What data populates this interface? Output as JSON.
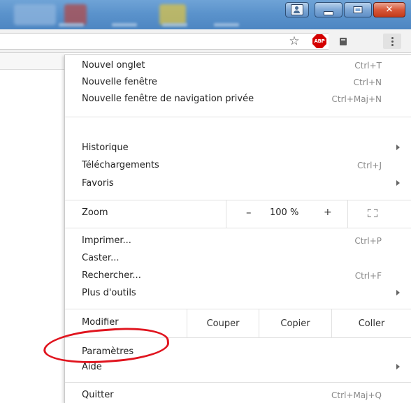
{
  "toolbar": {
    "bookmark_icon": "star-icon",
    "adblock_badge": "ABP",
    "extension_icon": "extension-icon",
    "menu_icon": "kebab-icon"
  },
  "menu": {
    "new_tab": {
      "label": "Nouvel onglet",
      "shortcut": "Ctrl+T"
    },
    "new_window": {
      "label": "Nouvelle fenêtre",
      "shortcut": "Ctrl+N"
    },
    "new_private_window": {
      "label": "Nouvelle fenêtre de navigation privée",
      "shortcut": "Ctrl+Maj+N"
    },
    "history": {
      "label": "Historique"
    },
    "downloads": {
      "label": "Téléchargements",
      "shortcut": "Ctrl+J"
    },
    "bookmarks": {
      "label": "Favoris"
    },
    "zoom": {
      "label": "Zoom",
      "minus": "–",
      "value": "100 %",
      "plus": "+"
    },
    "print": {
      "label": "Imprimer...",
      "shortcut": "Ctrl+P"
    },
    "cast": {
      "label": "Caster..."
    },
    "find": {
      "label": "Rechercher...",
      "shortcut": "Ctrl+F"
    },
    "more_tools": {
      "label": "Plus d'outils"
    },
    "edit": {
      "label": "Modifier",
      "cut": "Couper",
      "copy": "Copier",
      "paste": "Coller"
    },
    "settings": {
      "label": "Paramètres"
    },
    "help": {
      "label": "Aide"
    },
    "quit": {
      "label": "Quitter",
      "shortcut": "Ctrl+Maj+Q"
    }
  },
  "colors": {
    "highlight_circle": "#e0141e",
    "abp_red": "#d40000",
    "titlebar_blue": "#5b93cc"
  }
}
